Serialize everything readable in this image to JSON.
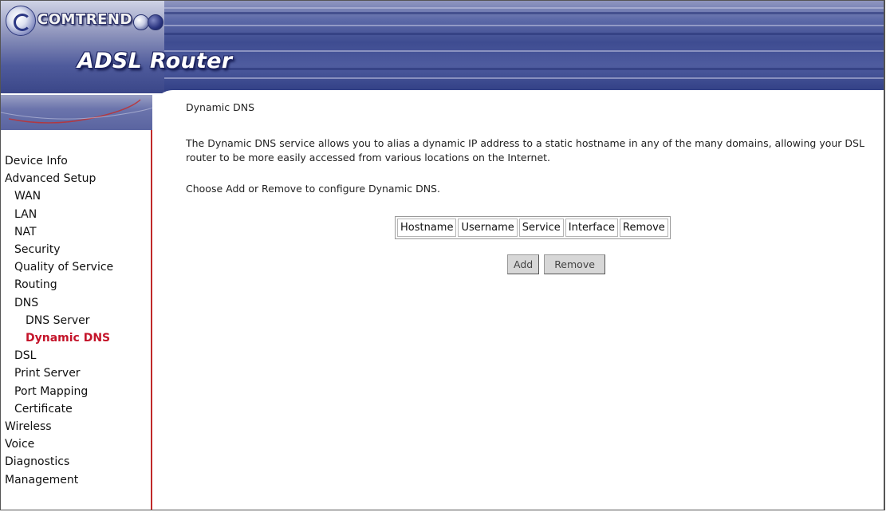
{
  "header": {
    "brand": "COMTREND",
    "product": "ADSL Router"
  },
  "sidebar": {
    "items": [
      {
        "label": "Device Info",
        "level": 1,
        "active": false
      },
      {
        "label": "Advanced Setup",
        "level": 1,
        "active": false
      },
      {
        "label": "WAN",
        "level": 2,
        "active": false
      },
      {
        "label": "LAN",
        "level": 2,
        "active": false
      },
      {
        "label": "NAT",
        "level": 2,
        "active": false
      },
      {
        "label": "Security",
        "level": 2,
        "active": false
      },
      {
        "label": "Quality of Service",
        "level": 2,
        "active": false
      },
      {
        "label": "Routing",
        "level": 2,
        "active": false
      },
      {
        "label": "DNS",
        "level": 2,
        "active": false
      },
      {
        "label": "DNS Server",
        "level": 3,
        "active": false
      },
      {
        "label": "Dynamic DNS",
        "level": 3,
        "active": true
      },
      {
        "label": "DSL",
        "level": 2,
        "active": false
      },
      {
        "label": "Print Server",
        "level": 2,
        "active": false
      },
      {
        "label": "Port Mapping",
        "level": 2,
        "active": false
      },
      {
        "label": "Certificate",
        "level": 2,
        "active": false
      },
      {
        "label": "Wireless",
        "level": 1,
        "active": false
      },
      {
        "label": "Voice",
        "level": 1,
        "active": false
      },
      {
        "label": "Diagnostics",
        "level": 1,
        "active": false
      },
      {
        "label": "Management",
        "level": 1,
        "active": false
      }
    ]
  },
  "main": {
    "title": "Dynamic DNS",
    "description": "The Dynamic DNS service allows you to alias a dynamic IP address to a static hostname in any of the many domains, allowing your DSL router to be more easily accessed from various locations on the Internet.",
    "hint": "Choose Add or Remove to configure Dynamic DNS.",
    "table_headers": [
      "Hostname",
      "Username",
      "Service",
      "Interface",
      "Remove"
    ],
    "buttons": {
      "add": "Add",
      "remove": "Remove"
    }
  },
  "colors": {
    "active_nav": "#c4142a",
    "sidebar_border": "#c02a2a",
    "header_blue": "#3e4c91"
  }
}
